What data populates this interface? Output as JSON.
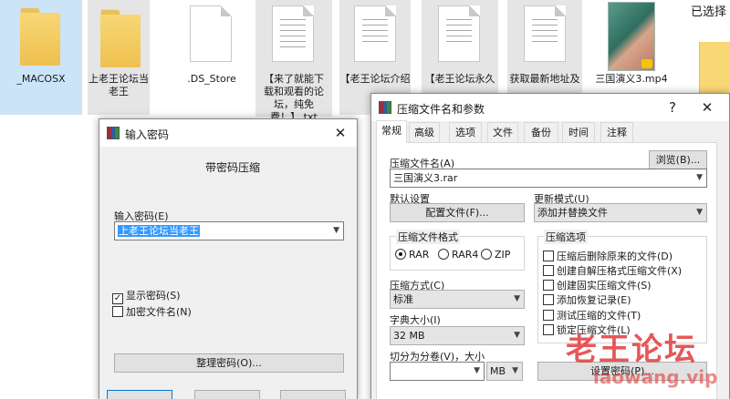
{
  "explorer": {
    "files": [
      {
        "label": "_MACOSX",
        "type": "folder"
      },
      {
        "label": "上老王论坛当老王",
        "type": "folder"
      },
      {
        "label": ".DS_Store",
        "type": "file"
      },
      {
        "label": "【来了就能下载和观看的论坛，纯免费！】.txt",
        "type": "text-file"
      },
      {
        "label": "【老王论坛介绍",
        "type": "text-file"
      },
      {
        "label": "【老王论坛永久",
        "type": "text-file"
      },
      {
        "label": "获取最新地址及",
        "type": "text-file"
      },
      {
        "label": "三国演义3.mp4",
        "type": "video"
      }
    ],
    "selected_text": "已选择",
    "video_badge": "Player"
  },
  "password_dialog": {
    "title": "输入密码",
    "heading": "带密码压缩",
    "password_label": "输入密码(E)",
    "password_value": "上老王论坛当老王",
    "show_password_label": "显示密码(S)",
    "show_password_checked": true,
    "encrypt_names_label": "加密文件名(N)",
    "encrypt_names_checked": false,
    "organize_button": "整理密码(O)...",
    "close_symbol": "✕"
  },
  "archive_dialog": {
    "title": "压缩文件名和参数",
    "help_symbol": "?",
    "close_symbol": "✕",
    "tabs": [
      "常规",
      "高级",
      "选项",
      "文件",
      "备份",
      "时间",
      "注释"
    ],
    "active_tab": 0,
    "archive_name_label": "压缩文件名(A)",
    "archive_name_value": "三国演义3.rar",
    "browse_button": "浏览(B)...",
    "default_settings_label": "默认设置",
    "profiles_button": "配置文件(F)...",
    "update_mode_label": "更新模式(U)",
    "update_mode_value": "添加并替换文件",
    "format_group_label": "压缩文件格式",
    "formats": [
      {
        "label": "RAR",
        "selected": true
      },
      {
        "label": "RAR4",
        "selected": false
      },
      {
        "label": "ZIP",
        "selected": false
      }
    ],
    "method_label": "压缩方式(C)",
    "method_value": "标准",
    "dict_label": "字典大小(I)",
    "dict_value": "32 MB",
    "split_label": "切分为分卷(V)，大小",
    "split_value": "",
    "split_unit": "MB",
    "options_group_label": "压缩选项",
    "options": [
      {
        "label": "压缩后删除原来的文件(D)",
        "checked": false
      },
      {
        "label": "创建自解压格式压缩文件(X)",
        "checked": false
      },
      {
        "label": "创建固实压缩文件(S)",
        "checked": false
      },
      {
        "label": "添加恢复记录(E)",
        "checked": false
      },
      {
        "label": "测试压缩的文件(T)",
        "checked": false
      },
      {
        "label": "锁定压缩文件(L)",
        "checked": false
      }
    ],
    "set_password_button": "设置密码(P)..."
  },
  "watermark": {
    "text": "老王论坛",
    "url": "laowang.vip"
  },
  "colors": {
    "selection_blue": "#3399ff",
    "folder_yellow": "#f8d775",
    "watermark_red": "#e23b3b"
  }
}
